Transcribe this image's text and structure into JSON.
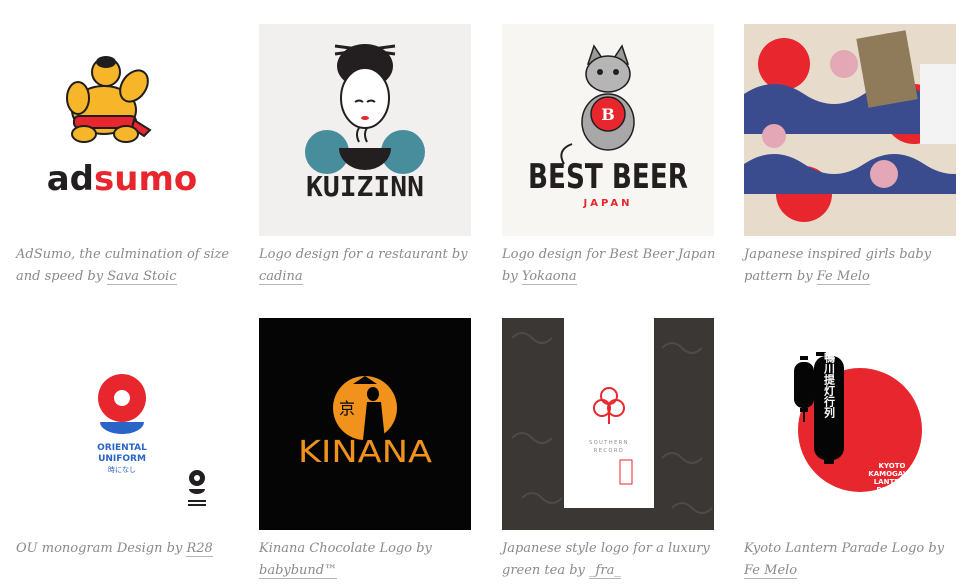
{
  "gallery": {
    "items": [
      {
        "logo_text": "adsumo",
        "logo_text_a": "ad",
        "logo_text_b": "sumo",
        "caption_pre": "AdSumo, the culmination of size and speed by",
        "author": "Sava Stoic"
      },
      {
        "logo_text": "KUIZINN",
        "caption_pre": "Logo design for a restaurant by",
        "author": "cadina"
      },
      {
        "logo_text": "BEST BEER",
        "logo_sub": "JAPAN",
        "caption_pre": "Logo design for Best Beer Japan by",
        "author": "Yokaona"
      },
      {
        "caption_pre": "Japanese inspired girls baby pattern by",
        "author": "Fe Melo"
      },
      {
        "logo_text": "ORIENTAL UNIFORM",
        "logo_line1": "ORIENTAL",
        "logo_line2": "UNIFORM",
        "logo_jp": "時になし",
        "caption_pre": "OU monogram Design by",
        "author": "R28"
      },
      {
        "logo_text": "KINANA",
        "logo_kanji": "京",
        "caption_pre": "Kinana Chocolate Logo by",
        "author": "babybund™"
      },
      {
        "logo_line1": "SOUTHERN",
        "logo_line2": "RECORD",
        "caption_pre": "Japanese style logo for a luxury green tea by",
        "author": "_fra_"
      },
      {
        "logo_vertical": "京都鴨川提灯行列",
        "logo_line1": "KYOTO",
        "logo_line2": "KAMOGAWA",
        "logo_line3": "LANTERN",
        "logo_line4": "PARADE",
        "caption_pre": "Kyoto Lantern Parade Logo by",
        "author": "Fe Melo"
      }
    ]
  },
  "colors": {
    "red": "#e8262d",
    "orange": "#f0921c",
    "teal": "#2a7b8c",
    "blue": "#2a64c7",
    "dark": "#231f20"
  }
}
